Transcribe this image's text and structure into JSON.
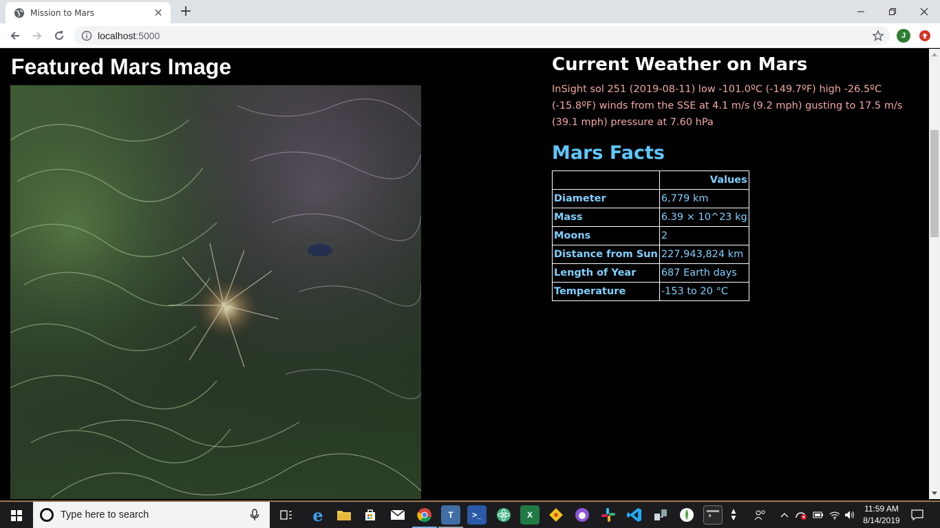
{
  "browser": {
    "tab_title": "Mission to Mars",
    "url_host": "localhost",
    "url_port": ":5000",
    "profile_initial": "J"
  },
  "page": {
    "featured": {
      "title": "Featured Mars Image"
    },
    "weather": {
      "title": "Current Weather on Mars",
      "report": "InSight sol 251 (2019-08-11) low -101.0ºC (-149.7ºF) high -26.5ºC (-15.8ºF) winds from the SSE at 4.1 m/s (9.2 mph) gusting to 17.5 m/s (39.1 mph) pressure at 7.60 hPa"
    },
    "facts": {
      "title": "Mars Facts",
      "header_label": "",
      "header_value": "Values",
      "rows": [
        {
          "label": "Diameter",
          "value": "6,779 km"
        },
        {
          "label": "Mass",
          "value": "6.39 × 10^23 kg"
        },
        {
          "label": "Moons",
          "value": "2"
        },
        {
          "label": "Distance from Sun",
          "value": "227,943,824 km"
        },
        {
          "label": "Length of Year",
          "value": "687 Earth days"
        },
        {
          "label": "Temperature",
          "value": "-153 to 20 °C"
        }
      ]
    }
  },
  "taskbar": {
    "search_placeholder": "Type here to search",
    "time": "11:59 AM",
    "date": "8/14/2019"
  },
  "colors": {
    "weather_text": "#f4a7a7",
    "facts_text": "#7fd0ff",
    "facts_title": "#5ec8ff",
    "page_bg": "#000000"
  }
}
